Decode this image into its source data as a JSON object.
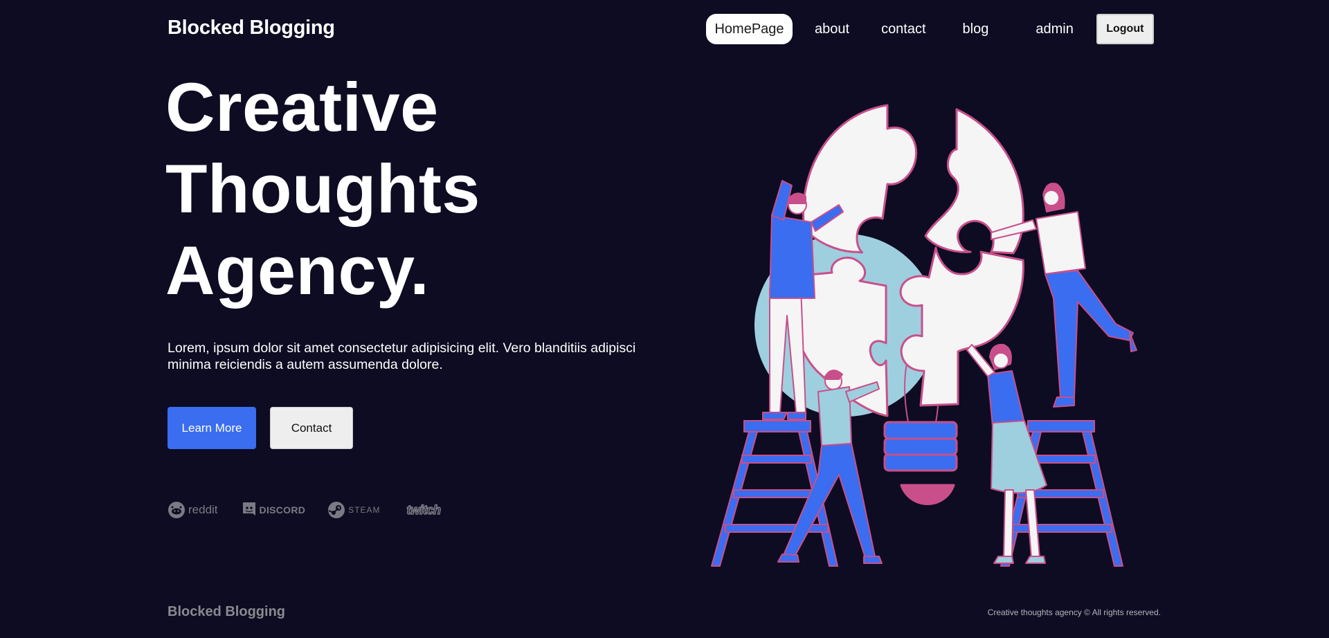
{
  "header": {
    "brand": "Blocked Blogging",
    "nav": {
      "home": "HomePage",
      "about": "about",
      "contact": "contact",
      "blog": "blog",
      "admin": "admin"
    },
    "logout_label": "Logout"
  },
  "hero": {
    "title_lines": [
      "Creative",
      "Thoughts",
      "Agency."
    ],
    "description": "Lorem, ipsum dolor sit amet consectetur adipisicing elit. Vero blanditiis adipisci minima reiciendis a autem assumenda dolore.",
    "learn_more_label": "Learn More",
    "contact_label": "Contact"
  },
  "brands": {
    "reddit": "reddit",
    "discord": "DISCORD",
    "steam": "STEAM",
    "twitch": "twitch"
  },
  "footer": {
    "brand": "Blocked Blogging",
    "copyright": "Creative thoughts agency © All rights reserved."
  },
  "colors": {
    "background": "#0d0c22",
    "accent_blue": "#3a6df0",
    "pink": "#c94f8a",
    "light_blue": "#9ecfdf",
    "puzzle_white": "#f5f5f5"
  },
  "icons": [
    "reddit-icon",
    "discord-icon",
    "steam-icon",
    "twitch-icon"
  ]
}
